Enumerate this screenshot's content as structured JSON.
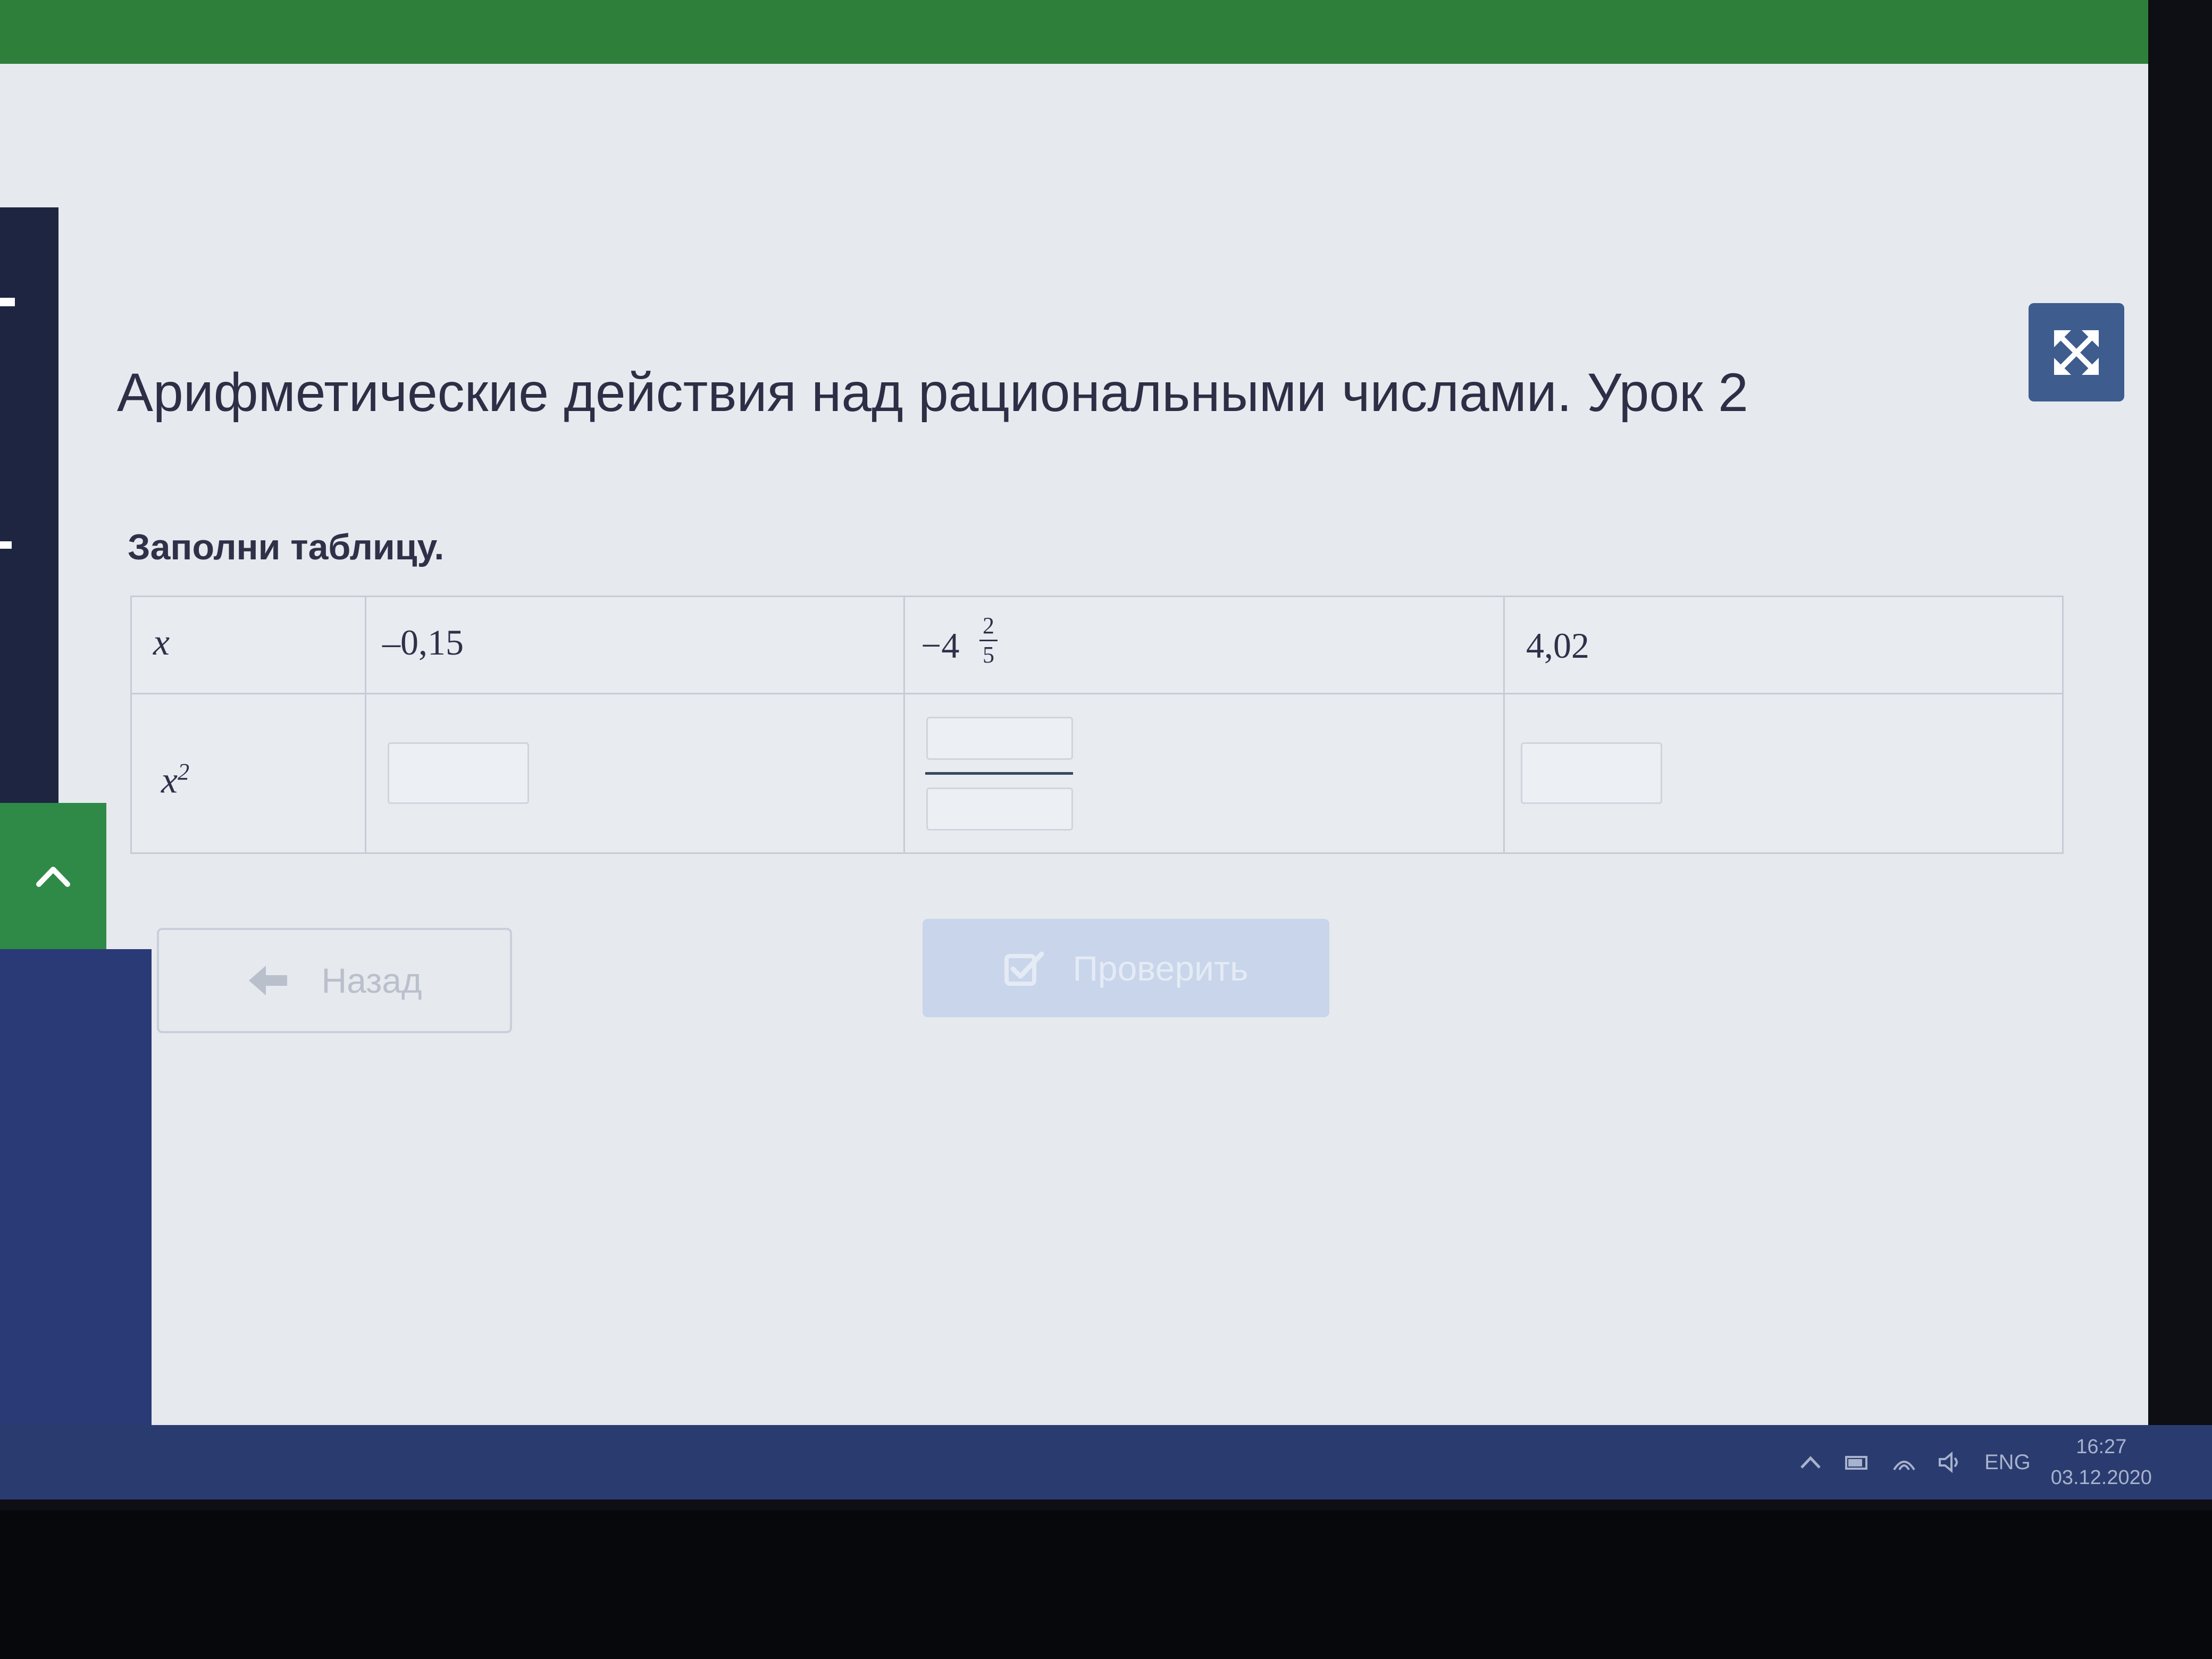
{
  "lesson": {
    "title": "Арифметические действия над рациональными числами. Урок 2",
    "prompt": "Заполни таблицу."
  },
  "table": {
    "row_x_label": "x",
    "row_x2_label": "x",
    "row_x2_exponent": "2",
    "values": {
      "col1": "–0,15",
      "col2_whole": "−4",
      "col2_numerator": "2",
      "col2_denominator": "5",
      "col3": "4,02"
    }
  },
  "buttons": {
    "back_label": "Назад",
    "check_label": "Проверить"
  },
  "taskbar": {
    "language": "ENG",
    "time": "16:27",
    "date": "03.12.2020"
  },
  "colors": {
    "accent_green": "#2e7f3a",
    "navy": "#2a3a76",
    "expand_button": "#3e5c8e",
    "check_button_disabled": "#c8d5ea"
  },
  "icons": [
    "chevron-up-icon",
    "expand-icon",
    "arrow-left-icon",
    "checkbox-icon",
    "up-caret-icon",
    "battery-icon",
    "network-icon",
    "speaker-icon"
  ]
}
